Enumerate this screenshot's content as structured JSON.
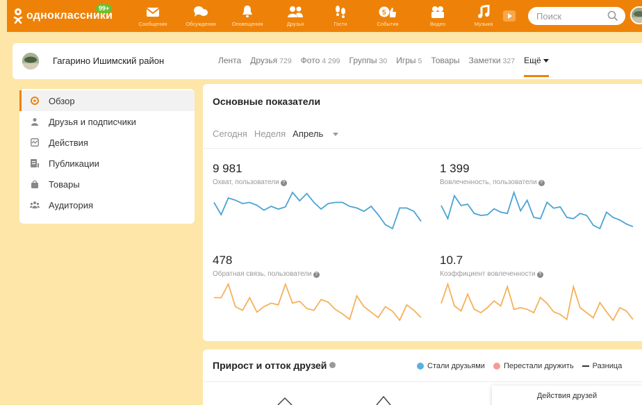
{
  "topbar": {
    "logo_text": "одноклассники",
    "badge": "99+",
    "nav": [
      {
        "label": "Сообщения",
        "icon": "envelope-icon"
      },
      {
        "label": "Обсуждения",
        "icon": "chat-bubbles-icon"
      },
      {
        "label": "Оповещения",
        "icon": "bell-icon"
      },
      {
        "label": "Друзья",
        "icon": "friends-icon"
      },
      {
        "label": "Гости",
        "icon": "footprints-icon"
      },
      {
        "label": "События",
        "icon": "events-icon"
      },
      {
        "label": "Видео",
        "icon": "video-camera-icon"
      },
      {
        "label": "Музыка",
        "icon": "music-note-icon"
      }
    ],
    "search_placeholder": "Поиск"
  },
  "profile": {
    "name": "Гагарино Ишимский район",
    "tabs": [
      {
        "label": "Лента",
        "count": ""
      },
      {
        "label": "Друзья",
        "count": "729"
      },
      {
        "label": "Фото",
        "count": "4 299"
      },
      {
        "label": "Группы",
        "count": "30"
      },
      {
        "label": "Игры",
        "count": "5"
      },
      {
        "label": "Товары",
        "count": ""
      },
      {
        "label": "Заметки",
        "count": "327"
      }
    ],
    "more_label": "Ещё"
  },
  "sidebar": {
    "items": [
      {
        "label": "Обзор",
        "icon": "eye-icon",
        "active": true
      },
      {
        "label": "Друзья и подписчики",
        "icon": "person-icon"
      },
      {
        "label": "Действия",
        "icon": "activity-icon"
      },
      {
        "label": "Публикации",
        "icon": "document-icon"
      },
      {
        "label": "Товары",
        "icon": "bag-icon"
      },
      {
        "label": "Аудитория",
        "icon": "audience-icon"
      }
    ]
  },
  "main": {
    "title": "Основные показатели",
    "periods": [
      "Сегодня",
      "Неделя",
      "Апрель"
    ],
    "metrics": [
      {
        "value": "9 981",
        "label": "Охват, пользователи",
        "color": "#4aa3d3",
        "series": [
          52,
          30,
          60,
          56,
          50,
          52,
          47,
          38,
          45,
          40,
          44,
          70,
          55,
          68,
          52,
          40,
          50,
          52,
          52,
          45,
          42,
          36,
          45,
          30,
          12,
          5,
          42,
          42,
          36,
          18
        ]
      },
      {
        "value": "1 399",
        "label": "Вовлеченность, пользователи",
        "color": "#4aa3d3",
        "series": [
          40,
          20,
          55,
          40,
          42,
          28,
          25,
          26,
          35,
          30,
          28,
          60,
          32,
          48,
          22,
          20,
          45,
          36,
          38,
          22,
          20,
          28,
          25,
          10,
          5,
          30,
          22,
          18,
          12,
          8
        ]
      },
      {
        "value": "478",
        "label": "Обратная связь, пользователи",
        "color": "#f4b15a",
        "series": [
          30,
          30,
          45,
          20,
          16,
          30,
          14,
          20,
          24,
          22,
          45,
          24,
          26,
          18,
          16,
          28,
          25,
          17,
          12,
          6,
          32,
          20,
          14,
          8,
          20,
          15,
          5,
          22,
          16,
          8
        ]
      },
      {
        "value": "10.7",
        "label": "Коэффициент вовлеченности",
        "color": "#f4b15a",
        "series": [
          25,
          48,
          22,
          16,
          36,
          18,
          14,
          20,
          28,
          22,
          45,
          18,
          20,
          18,
          14,
          32,
          25,
          15,
          12,
          6,
          45,
          20,
          14,
          8,
          26,
          15,
          5,
          20,
          16,
          6
        ]
      }
    ]
  },
  "friends_panel": {
    "title": "Прирост и отток друзей",
    "legend": [
      {
        "label": "Стали друзьями",
        "color": "#5ab0e0"
      },
      {
        "label": "Перестали дружить",
        "color": "#f59a9a"
      },
      {
        "label": "Разница",
        "color": "#333333"
      }
    ],
    "tooltip_title": "Действия друзей"
  },
  "colors": {
    "accent": "#ee8208",
    "blue": "#4aa3d3",
    "orange": "#f4b15a",
    "badge": "#6bc02f"
  }
}
